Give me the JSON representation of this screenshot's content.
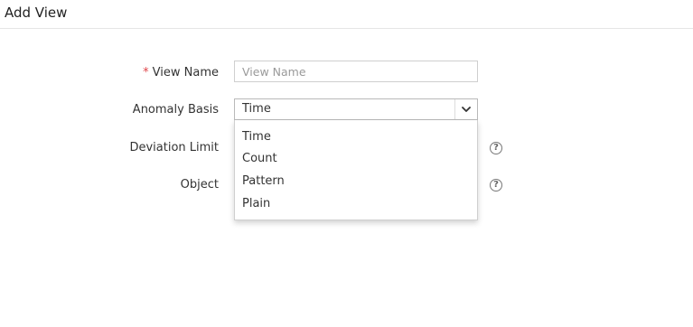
{
  "header": {
    "title": "Add View"
  },
  "form": {
    "view_name": {
      "required_mark": "*",
      "label": "View Name",
      "placeholder": "View Name",
      "value": ""
    },
    "anomaly_basis": {
      "label": "Anomaly Basis",
      "selected": "Time",
      "options": [
        "Time",
        "Count",
        "Pattern",
        "Plain"
      ],
      "expanded": true
    },
    "deviation_limit": {
      "label": "Deviation Limit",
      "help_icon": "?"
    },
    "object": {
      "label": "Object",
      "help_icon": "?"
    }
  },
  "icons": {
    "caret": "chevron-down-icon",
    "help": "question-circle-icon"
  },
  "colors": {
    "required": "#e0464b",
    "border": "#cfcfcf"
  }
}
